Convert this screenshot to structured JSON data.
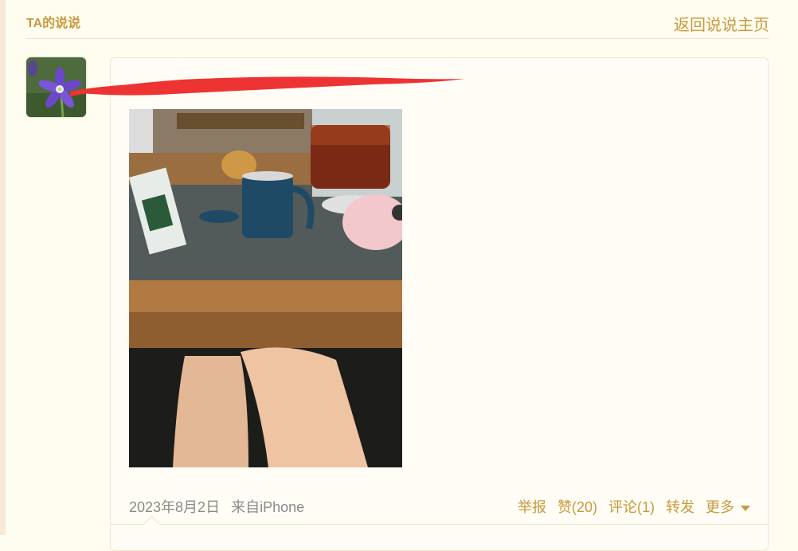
{
  "header": {
    "title": "TA的说说",
    "back_link": "返回说说主页"
  },
  "post": {
    "username": "",
    "date": "2023年8月2日",
    "source": "来自iPhone",
    "actions": {
      "report": "举报",
      "like": "赞(20)",
      "comment": "评论(1)",
      "forward": "转发",
      "more": "更多"
    }
  },
  "colors": {
    "accent": "#c89a3c",
    "background": "#fffcf0",
    "redaction": "#ee3333"
  }
}
